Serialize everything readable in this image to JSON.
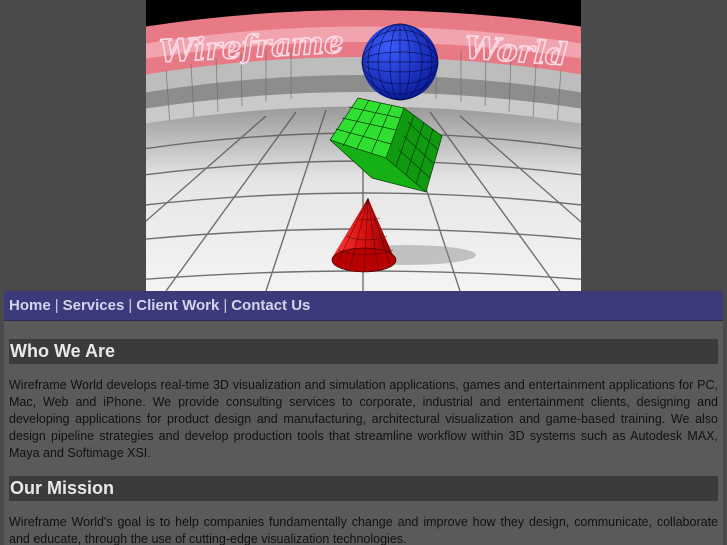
{
  "banner": {
    "title_left": "Wireframe",
    "title_right": "World"
  },
  "nav": {
    "items": [
      {
        "label": "Home"
      },
      {
        "label": "Services"
      },
      {
        "label": "Client Work"
      },
      {
        "label": "Contact Us"
      }
    ],
    "separator": "|"
  },
  "sections": [
    {
      "heading": "Who We Are",
      "body": "Wireframe World develops real-time 3D visualization and simulation applications, games and entertainment applications for PC, Mac, Web and iPhone. We provide consulting services to corporate, industrial and entertainment clients, designing and developing applications for product design and manufacturing, architectural visualization and game-based training. We also design pipeline strategies and develop production tools that streamline workflow within 3D systems such as Autodesk MAX, Maya and Softimage XSI."
    },
    {
      "heading": "Our Mission",
      "body": "Wireframe World's goal is to help companies fundamentally change and improve how they design, communicate, collaborate and educate, through the use of cutting-edge visualization technologies."
    }
  ],
  "colors": {
    "page_bg": "#4a4a4a",
    "nav_bg": "#3b3b7c",
    "content_bg": "#5a5a5a",
    "heading_bg": "#3b3b3b",
    "sphere": "#1530d8",
    "cube": "#1ec41e",
    "cone": "#e01414"
  }
}
